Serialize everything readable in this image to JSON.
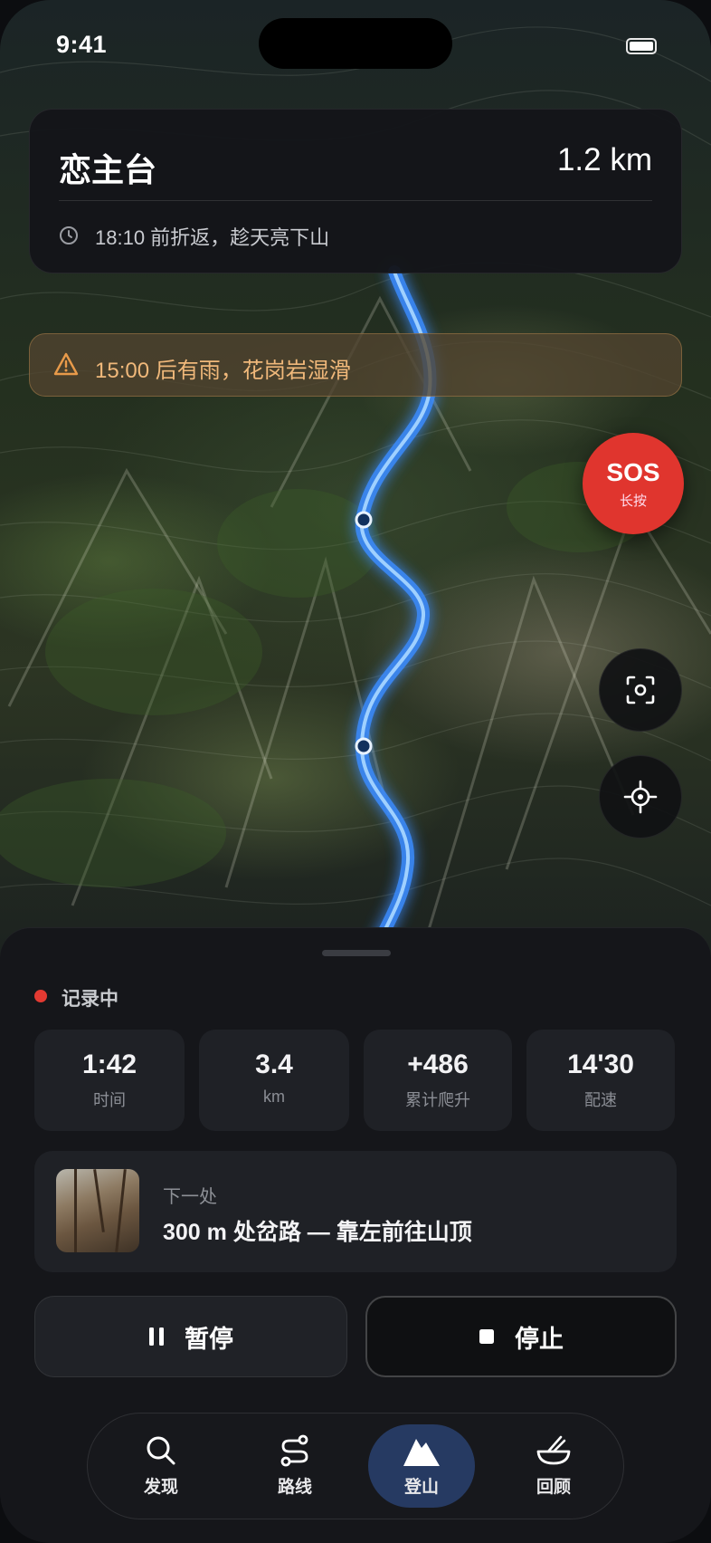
{
  "status_bar": {
    "time": "9:41"
  },
  "header": {
    "destination": "恋主台",
    "distance": "1.2 km",
    "turnaround": "18:10 前折返，趁天亮下山",
    "icon": "clock-icon"
  },
  "alert": {
    "text": "15:00 后有雨，花岗岩湿滑",
    "icon": "warning-triangle-icon",
    "color": "#f0b87a"
  },
  "sos": {
    "label": "SOS",
    "sublabel": "长按",
    "color": "#e0352e"
  },
  "map_controls": {
    "scan_icon": "scan-icon",
    "locate_icon": "crosshair-icon"
  },
  "recording": {
    "label": "记录中",
    "stats": [
      {
        "value": "1:42",
        "unit": "时间"
      },
      {
        "value": "3.4",
        "unit": "km"
      },
      {
        "value": "+486",
        "unit": "累计爬升"
      },
      {
        "value": "14'30",
        "unit": "配速"
      }
    ]
  },
  "next_step": {
    "label": "下一处",
    "text": "300 m 处岔路 — 靠左前往山顶"
  },
  "actions": {
    "pause": "暂停",
    "stop": "停止"
  },
  "tabs": [
    {
      "label": "发现",
      "icon": "search-icon"
    },
    {
      "label": "路线",
      "icon": "route-icon"
    },
    {
      "label": "登山",
      "icon": "mountain-icon",
      "active": true
    },
    {
      "label": "回顾",
      "icon": "bowl-icon"
    }
  ],
  "colors": {
    "route": "#3a8cff",
    "accent_tab": "#263a62"
  }
}
